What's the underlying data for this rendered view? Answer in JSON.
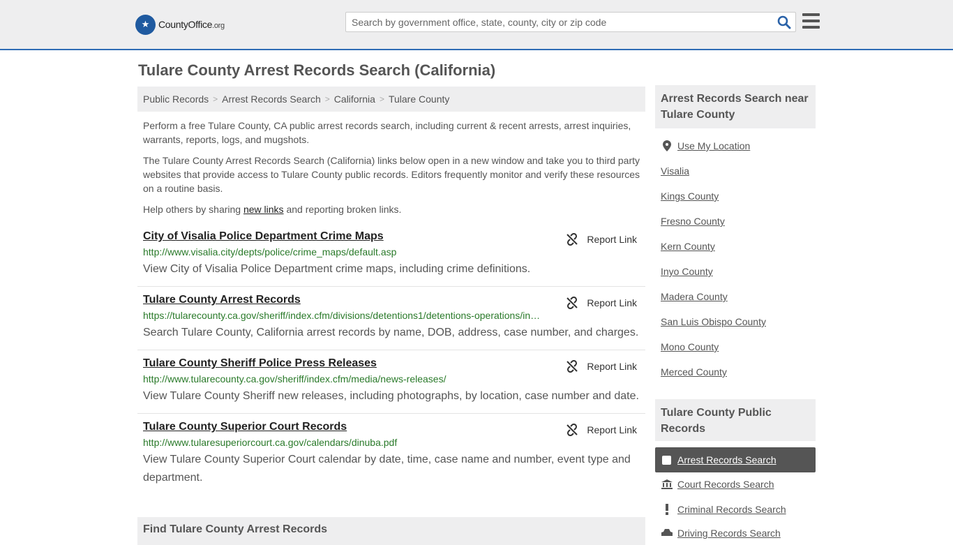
{
  "header": {
    "logo_text": "CountyOffice",
    "logo_tld": ".org",
    "search_placeholder": "Search by government office, state, county, city or zip code"
  },
  "page_title": "Tulare County Arrest Records Search (California)",
  "breadcrumb": [
    "Public Records",
    "Arrest Records Search",
    "California",
    "Tulare County"
  ],
  "intro": {
    "p1": "Perform a free Tulare County, CA public arrest records search, including current & recent arrests, arrest inquiries, warrants, reports, logs, and mugshots.",
    "p2": "The Tulare County Arrest Records Search (California) links below open in a new window and take you to third party websites that provide access to Tulare County public records. Editors frequently monitor and verify these resources on a routine basis.",
    "p3_before": "Help others by sharing ",
    "p3_link": "new links",
    "p3_after": " and reporting broken links."
  },
  "results": [
    {
      "title": "City of Visalia Police Department Crime Maps",
      "url": "http://www.visalia.city/depts/police/crime_maps/default.asp",
      "desc": "View City of Visalia Police Department crime maps, including crime definitions.",
      "report": "Report Link"
    },
    {
      "title": "Tulare County Arrest Records",
      "url": "https://tularecounty.ca.gov/sheriff/index.cfm/divisions/detentions1/detentions-operations/in…",
      "desc": "Search Tulare County, California arrest records by name, DOB, address, case number, and charges.",
      "report": "Report Link"
    },
    {
      "title": "Tulare County Sheriff Police Press Releases",
      "url": "http://www.tularecounty.ca.gov/sheriff/index.cfm/media/news-releases/",
      "desc": "View Tulare County Sheriff new releases, including photographs, by location, case number and date.",
      "report": "Report Link"
    },
    {
      "title": "Tulare County Superior Court Records",
      "url": "http://www.tularesuperiorcourt.ca.gov/calendars/dinuba.pdf",
      "desc": "View Tulare County Superior Court calendar by date, time, case name and number, event type and department.",
      "report": "Report Link"
    }
  ],
  "find_heading": "Find Tulare County Arrest Records",
  "sidebar": {
    "near_heading": "Arrest Records Search near Tulare County",
    "use_location": "Use My Location",
    "near_links": [
      "Visalia",
      "Kings County",
      "Fresno County",
      "Kern County",
      "Inyo County",
      "Madera County",
      "San Luis Obispo County",
      "Mono County",
      "Merced County"
    ],
    "public_heading": "Tulare County Public Records",
    "public_links": [
      "Arrest Records Search",
      "Court Records Search",
      "Criminal Records Search",
      "Driving Records Search"
    ]
  }
}
